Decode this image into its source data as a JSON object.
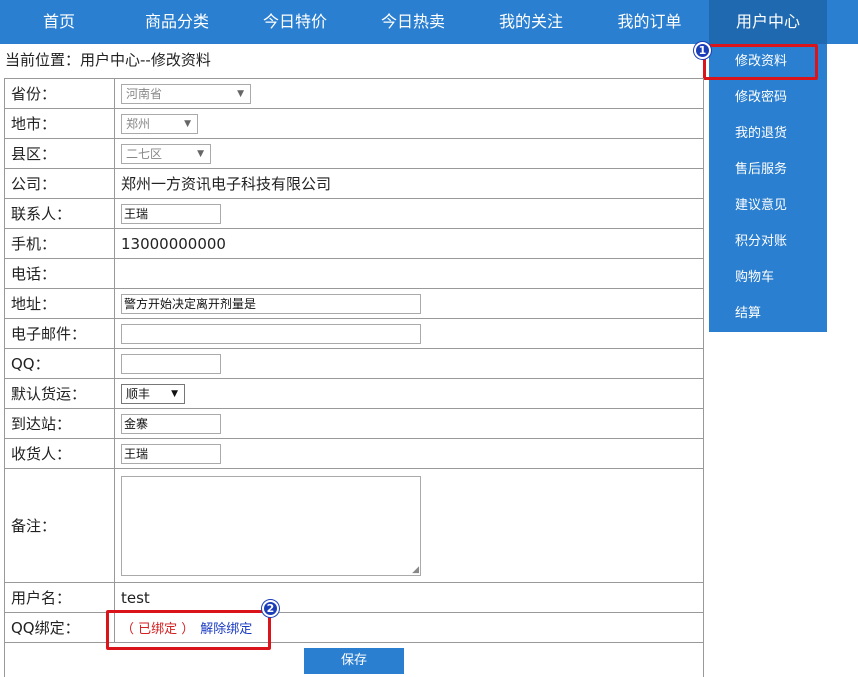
{
  "nav": {
    "items": [
      "首页",
      "商品分类",
      "今日特价",
      "今日热卖",
      "我的关注",
      "我的订单",
      "用户中心"
    ],
    "active": "用户中心"
  },
  "dropdown": {
    "items": [
      "修改资料",
      "修改密码",
      "我的退货",
      "售后服务",
      "建议意见",
      "积分对账",
      "购物车",
      "结算"
    ],
    "active": "修改资料"
  },
  "annotations": {
    "badge1": "1",
    "badge2": "2",
    "highlight_color": "#d9141b",
    "badge_color": "#1b3eb8"
  },
  "breadcrumb": "当前位置：用户中心--修改资料",
  "form": {
    "province": {
      "label": "省份：",
      "value": "河南省"
    },
    "city": {
      "label": "地市：",
      "value": "郑州"
    },
    "district": {
      "label": "县区：",
      "value": "二七区"
    },
    "company": {
      "label": "公司：",
      "value": "郑州一方资讯电子科技有限公司"
    },
    "contact": {
      "label": "联系人：",
      "value": "王瑞"
    },
    "mobile": {
      "label": "手机：",
      "value": "13000000000"
    },
    "phone": {
      "label": "电话：",
      "value": ""
    },
    "address": {
      "label": "地址：",
      "value": "警方开始决定离开剂量是"
    },
    "email": {
      "label": "电子邮件：",
      "value": ""
    },
    "qq": {
      "label": "QQ：",
      "value": ""
    },
    "shipping": {
      "label": "默认货运：",
      "value": "顺丰"
    },
    "station": {
      "label": "到达站：",
      "value": "金寨"
    },
    "receiver": {
      "label": "收货人：",
      "value": "王瑞"
    },
    "remark": {
      "label": "备注：",
      "value": ""
    },
    "username": {
      "label": "用户名：",
      "value": "test"
    },
    "qq_bind": {
      "label": "QQ绑定：",
      "status": "（ 已绑定 ）",
      "action": "解除绑定"
    },
    "save_label": "保存"
  },
  "colors": {
    "nav_bg": "#2b7fd0",
    "nav_active": "#1f69b0"
  }
}
